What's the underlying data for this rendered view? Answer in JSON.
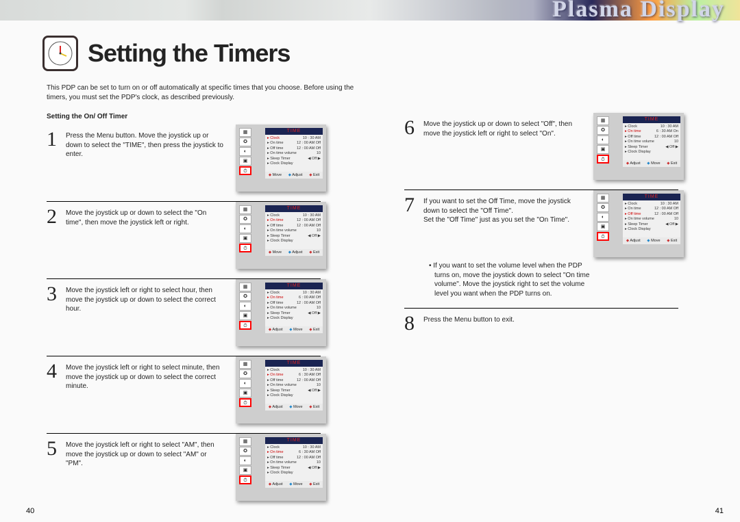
{
  "header": {
    "brand": "Plasma Display"
  },
  "title": "Setting the Timers",
  "intro": "This PDP can be set to turn on or off automatically at specific times that you choose. Before using the timers, you must set the PDP's clock, as described previously.",
  "subhead": "Setting the On/ Off Timer",
  "pages": {
    "left": "40",
    "right": "41"
  },
  "steps_left": [
    {
      "n": "1",
      "text": "Press the Menu button. Move the joystick up or down to select the \"TIME\", then press the joystick to enter."
    },
    {
      "n": "2",
      "text": "Move the joystick up or down to select the \"On time\", then move the joystick left or right."
    },
    {
      "n": "3",
      "text": "Move the joystick left or right to select hour, then move the joystick up or down to select the correct hour."
    },
    {
      "n": "4",
      "text": "Move the joystick left or right to select minute, then move the joystick up or down to select the correct minute."
    },
    {
      "n": "5",
      "text": "Move the joystick left or right to select \"AM\", then move the joystick up or down to select \"AM\" or \"PM\"."
    }
  ],
  "steps_right": [
    {
      "n": "6",
      "text": "Move the joystick up or down to select \"Off\", then move the joystick left or right to select \"On\"."
    },
    {
      "n": "7",
      "text": "If you want to set the Off Time, move the joystick down to select the \"Off Time\".\nSet the \"Off Time\" just as you set the \"On Time\"."
    },
    {
      "n": "8",
      "text": "Press the Menu button to exit."
    }
  ],
  "note": "• If you want to set the volume level when the PDP turns on, move the joystick down to select \"On time volume\". Move the joystick right to set the volume level you want when the PDP turns on.",
  "thumb": {
    "header": "TIME",
    "rows": [
      {
        "label": "Clock",
        "value": "10 : 30  AM"
      },
      {
        "label": "On time",
        "value": "12 : 00  AM  Off"
      },
      {
        "label": "Off time",
        "value": "12 : 00  AM  Off"
      },
      {
        "label": "On time volume",
        "value": "10"
      },
      {
        "label": "Sleep Timer",
        "value": "◀  Off  ▶"
      },
      {
        "label": "Clock Display",
        "value": ""
      }
    ],
    "footer": [
      "Adjust",
      "Move",
      "Exit"
    ],
    "footer_alt": [
      "Move",
      "Adjust",
      "Exit"
    ]
  },
  "thumb_variants": {
    "s1": {
      "highlight_row": 0,
      "footer": "alt",
      "sidebar": 4
    },
    "s2": {
      "highlight_row": 1,
      "footer": "alt",
      "sidebar": 4
    },
    "s3": {
      "highlight_row": 1,
      "footer": "main",
      "sidebar": 4,
      "on_value": "6 : 00  AM  Off"
    },
    "s4": {
      "highlight_row": 1,
      "footer": "main",
      "sidebar": 4,
      "on_value": "6 : 30  AM  Off"
    },
    "s5": {
      "highlight_row": 1,
      "footer": "main",
      "sidebar": 4,
      "on_value": "6 : 30  AM  Off"
    },
    "s6": {
      "highlight_row": 1,
      "footer": "main",
      "sidebar": 4,
      "on_value": "6 : 30  AM  On"
    },
    "s7": {
      "highlight_row": 2,
      "footer": "main",
      "sidebar": 4
    }
  }
}
